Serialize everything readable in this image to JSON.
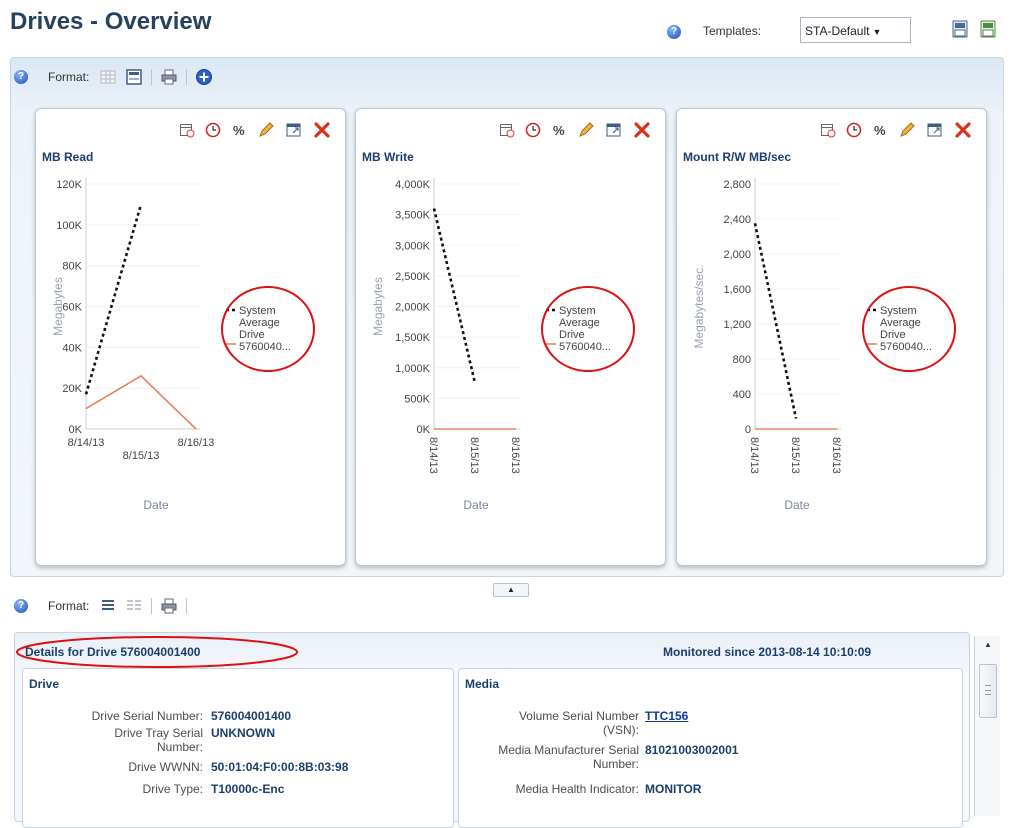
{
  "header": {
    "title": "Drives - Overview",
    "templates_label": "Templates:",
    "template_value": "STA-Default"
  },
  "format_label": "Format:",
  "charts": [
    {
      "title": "MB Read",
      "ylabel": "Megabytes",
      "xlabel": "Date",
      "yticks": [
        "120K",
        "100K",
        "80K",
        "60K",
        "40K",
        "20K",
        "0K"
      ],
      "xticks": [
        "8/14/13",
        "8/15/13",
        "8/16/13"
      ],
      "legend": [
        "System Average",
        "Drive 5760040..."
      ]
    },
    {
      "title": "MB Write",
      "ylabel": "Megabytes",
      "xlabel": "Date",
      "yticks": [
        "4,000K",
        "3,500K",
        "3,000K",
        "2,500K",
        "2,000K",
        "1,500K",
        "1,000K",
        "500K",
        "0K"
      ],
      "xticks": [
        "8/14/13",
        "8/15/13",
        "8/16/13"
      ],
      "legend": [
        "System Average",
        "Drive 5760040..."
      ]
    },
    {
      "title": "Mount R/W MB/sec",
      "ylabel": "Megabytes/sec.",
      "xlabel": "Date",
      "yticks": [
        "2,800",
        "2,400",
        "2,000",
        "1,600",
        "1,200",
        "800",
        "400",
        "0"
      ],
      "xticks": [
        "8/14/13",
        "8/15/13",
        "8/16/13"
      ],
      "legend": [
        "System Average",
        "Drive 5760040..."
      ]
    }
  ],
  "chart_data": [
    {
      "type": "line",
      "title": "MB Read",
      "xlabel": "Date",
      "ylabel": "Megabytes",
      "x": [
        "8/14/13",
        "8/15/13",
        "8/16/13"
      ],
      "ylim": [
        0,
        120000
      ],
      "series": [
        {
          "name": "System Average",
          "values": [
            17000,
            110000,
            null
          ],
          "color": "#111111",
          "style": "dashed"
        },
        {
          "name": "Drive 5760040...",
          "values": [
            10000,
            26000,
            0
          ],
          "color": "#e8825a",
          "style": "solid"
        }
      ]
    },
    {
      "type": "line",
      "title": "MB Write",
      "xlabel": "Date",
      "ylabel": "Megabytes",
      "x": [
        "8/14/13",
        "8/15/13",
        "8/16/13"
      ],
      "ylim": [
        0,
        4000000
      ],
      "series": [
        {
          "name": "System Average",
          "values": [
            3600000,
            750000,
            null
          ],
          "color": "#111111",
          "style": "dashed"
        },
        {
          "name": "Drive 5760040...",
          "values": [
            0,
            0,
            0
          ],
          "color": "#e8825a",
          "style": "solid"
        }
      ]
    },
    {
      "type": "line",
      "title": "Mount R/W MB/sec",
      "xlabel": "Date",
      "ylabel": "Megabytes/sec.",
      "x": [
        "8/14/13",
        "8/15/13",
        "8/16/13"
      ],
      "ylim": [
        0,
        2800
      ],
      "series": [
        {
          "name": "System Average",
          "values": [
            2350,
            120,
            null
          ],
          "color": "#111111",
          "style": "dashed"
        },
        {
          "name": "Drive 5760040...",
          "values": [
            0,
            0,
            0
          ],
          "color": "#e8825a",
          "style": "solid"
        }
      ]
    }
  ],
  "details": {
    "title": "Details for Drive 576004001400",
    "monitored_since": "Monitored since 2013-08-14 10:10:09",
    "drive": {
      "title": "Drive",
      "fields": [
        {
          "label": "Drive Serial Number:",
          "value": "576004001400"
        },
        {
          "label": "Drive Tray Serial Number:",
          "value": "UNKNOWN"
        },
        {
          "label": "Drive WWNN:",
          "value": "50:01:04:F0:00:8B:03:98"
        },
        {
          "label": "Drive Type:",
          "value": "T10000c-Enc"
        }
      ]
    },
    "media": {
      "title": "Media",
      "fields": [
        {
          "label": "Volume Serial Number (VSN):",
          "value": "TTC156"
        },
        {
          "label": "Media Manufacturer Serial Number:",
          "value": "81021003002001"
        },
        {
          "label": "Media Health Indicator:",
          "value": "MONITOR"
        }
      ]
    }
  },
  "colors": {
    "title": "#27415e",
    "section_title": "#1b3f6d",
    "system_average": "#111111",
    "drive_line": "#e8825a",
    "highlight_circle": "#dd1111"
  }
}
